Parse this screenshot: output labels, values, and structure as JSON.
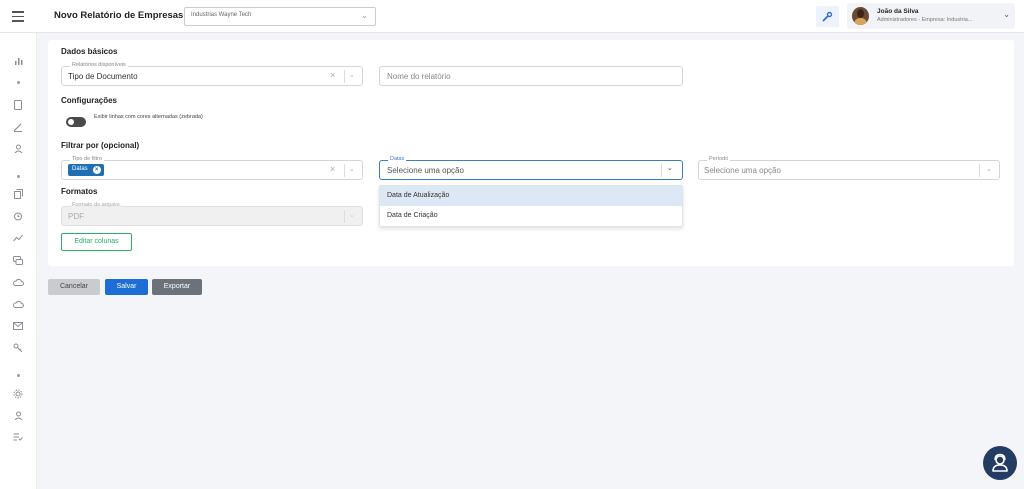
{
  "header": {
    "menu_icon": "hamburger-icon",
    "title": "Novo Relatório de Empresas",
    "company_select": {
      "value": "Industrias Wayne Tech"
    },
    "tools_icon": "wrench-icon",
    "user": {
      "name": "João da Silva",
      "role": "Administradores - Empresa: Industria..."
    }
  },
  "sidebar": {
    "icons": [
      "chart-icon",
      "document-icon",
      "pen-icon",
      "user-icon",
      "copy-icon",
      "alarm-icon",
      "trend-icon",
      "chat-icon",
      "cloud-icon",
      "cloud-icon",
      "mail-icon",
      "key-icon",
      "gear-icon",
      "person-icon",
      "list-check-icon"
    ]
  },
  "form": {
    "basic": {
      "title": "Dados básicos",
      "report_type": {
        "legend": "Relatórios disponíveis",
        "value": "Tipo de Documento"
      },
      "report_name": {
        "placeholder": "Nome do relatório"
      }
    },
    "config": {
      "title": "Configurações",
      "toggle_label": "Exibir linhas com cores alternadas (zebrada)",
      "toggle_on": false
    },
    "filter": {
      "title": "Filtrar por (opcional)",
      "filter_type": {
        "legend": "Tipo de filtro",
        "chip": "Datas"
      },
      "dates": {
        "legend": "Datas",
        "placeholder": "Selecione uma opção"
      },
      "period": {
        "legend": "Período",
        "placeholder": "Selecione uma opção"
      },
      "dates_options": [
        "Data de Atualização",
        "Data de Criação"
      ]
    },
    "formats": {
      "title": "Formatos",
      "file_format": {
        "legend": "Formato do arquivo",
        "value": "PDF"
      }
    },
    "edit_columns": "Editar colunas"
  },
  "actions": {
    "cancel": "Cancelar",
    "save": "Salvar",
    "export": "Exportar"
  },
  "colors": {
    "primary": "#1d6ed4",
    "success": "#2bae66",
    "secondary": "#6c7279",
    "fab": "#243b63"
  }
}
